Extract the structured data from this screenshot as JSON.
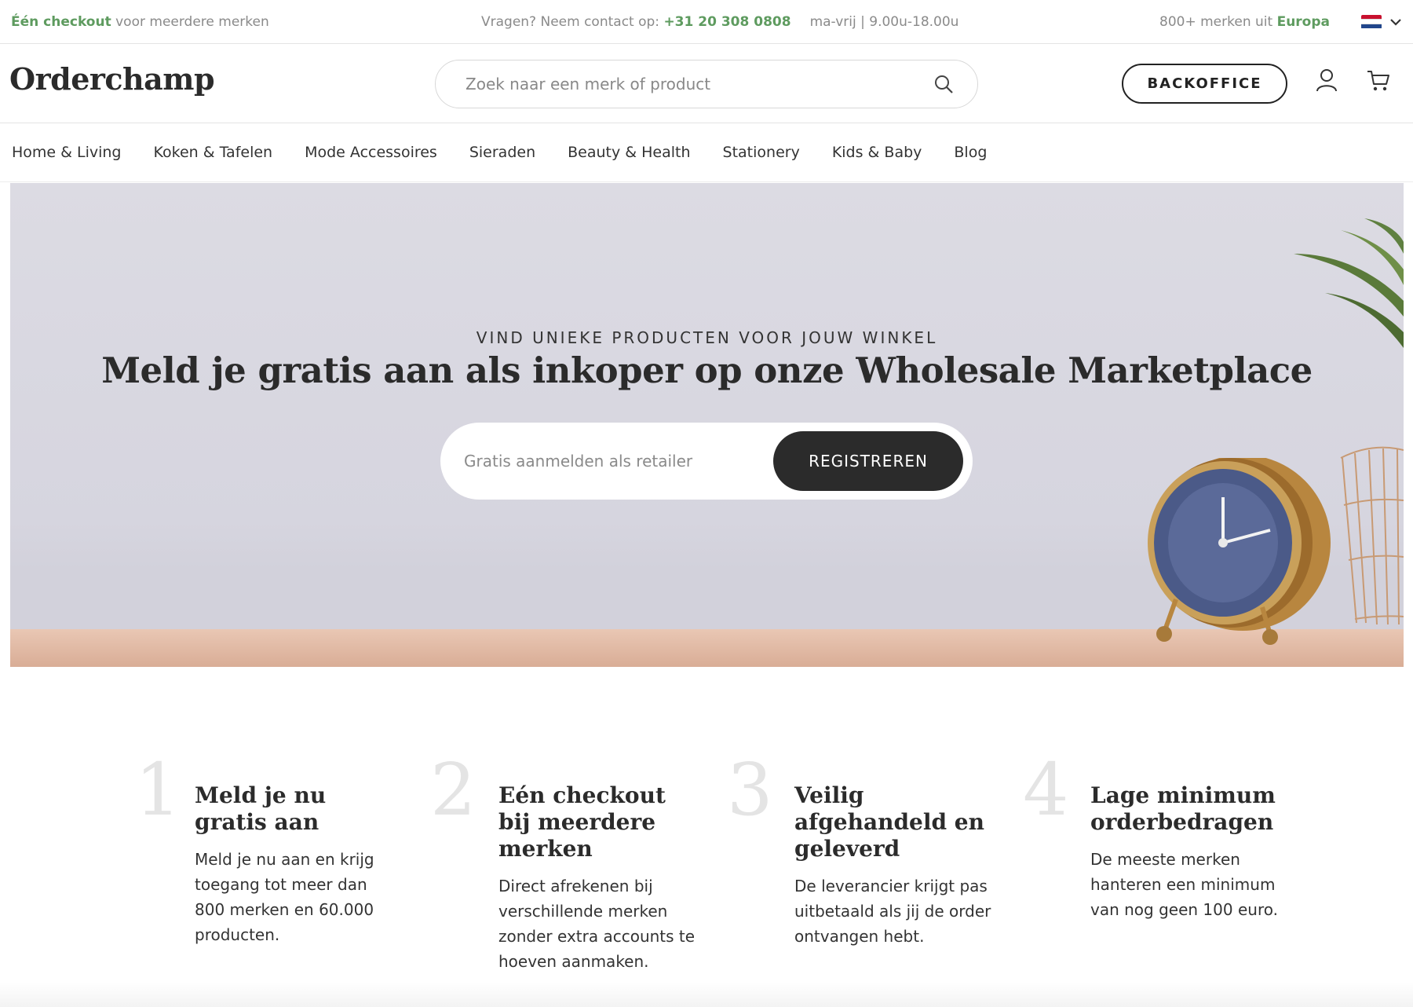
{
  "topbar": {
    "left_bold": "Één checkout",
    "left_rest": " voor meerdere merken",
    "contact_prefix": "Vragen? Neem contact op: ",
    "phone": "+31 20 308 0808",
    "hours": "ma-vrij | 9.00u-18.00u",
    "brands_prefix": "800+ merken uit ",
    "brands_region": "Europa"
  },
  "header": {
    "logo": "Orderchamp",
    "search_placeholder": "Zoek naar een merk of product",
    "backoffice_label": "BACKOFFICE"
  },
  "nav": {
    "items": [
      {
        "label": "Home & Living"
      },
      {
        "label": "Koken & Tafelen"
      },
      {
        "label": "Mode Accessoires"
      },
      {
        "label": "Sieraden"
      },
      {
        "label": "Beauty & Health"
      },
      {
        "label": "Stationery"
      },
      {
        "label": "Kids & Baby"
      },
      {
        "label": "Blog"
      }
    ]
  },
  "hero": {
    "kicker": "VIND UNIEKE PRODUCTEN VOOR JOUW WINKEL",
    "title": "Meld je gratis aan als inkoper op onze Wholesale Marketplace",
    "signup_placeholder": "Gratis aanmelden als retailer",
    "register_label": "REGISTREREN"
  },
  "steps": [
    {
      "num": "1",
      "title": "Meld je nu gratis aan",
      "text": "Meld je nu aan en krijg toegang tot meer dan 800 merken en 60.000 producten."
    },
    {
      "num": "2",
      "title": "Eén checkout bij meerdere merken",
      "text": "Direct afrekenen bij verschillende merken zonder extra accounts te hoeven aanmaken."
    },
    {
      "num": "3",
      "title": "Veilig afgehandeld en geleverd",
      "text": "De leverancier krijgt pas uitbetaald als jij de order ontvangen hebt."
    },
    {
      "num": "4",
      "title": "Lage minimum orderbedragen",
      "text": "De meeste merken hanteren een minimum van nog geen 100 euro."
    }
  ],
  "colors": {
    "accent_green": "#5e9b5f",
    "dark": "#2b2b2b"
  }
}
